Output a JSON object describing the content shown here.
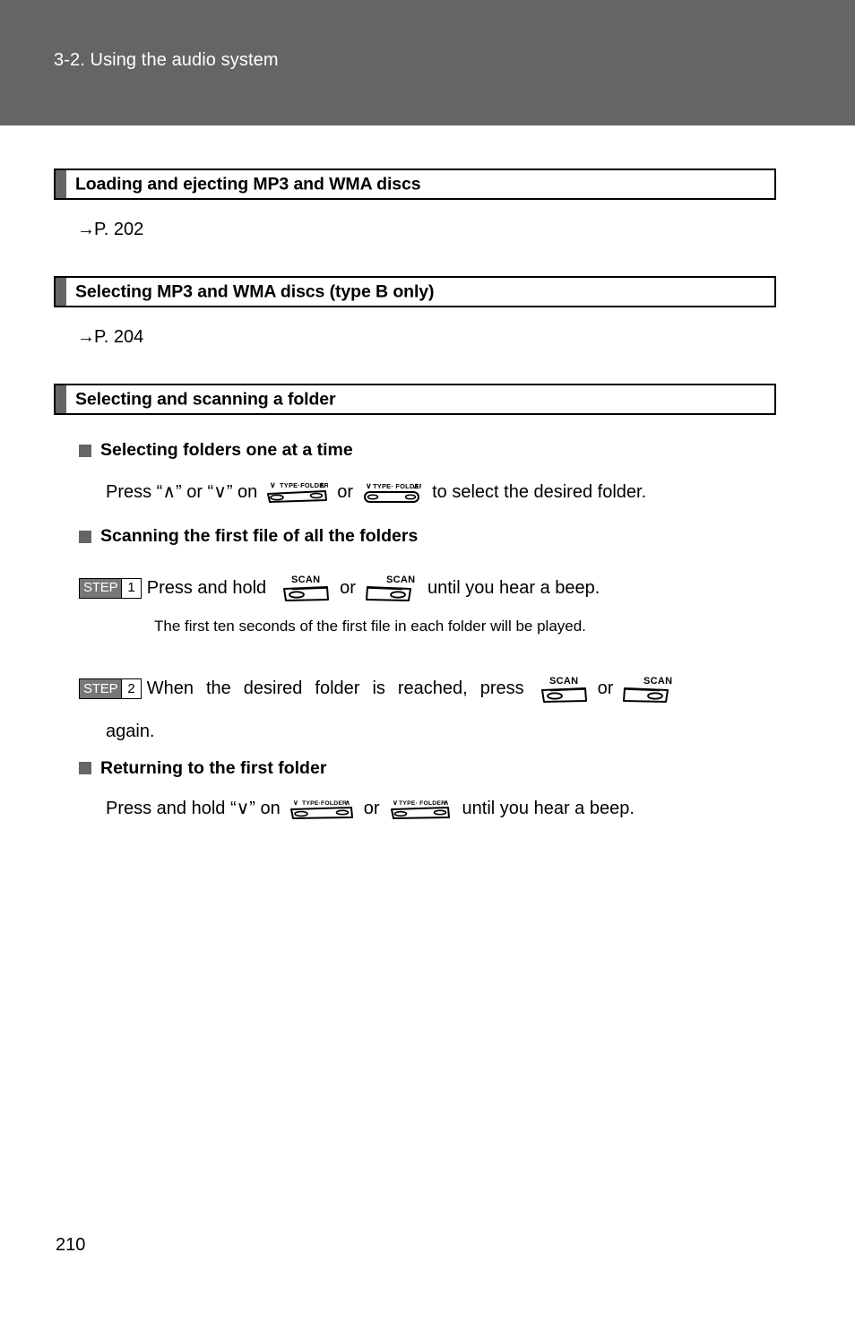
{
  "page": {
    "header_title": "3-2. Using the audio system",
    "page_number": "210"
  },
  "sections": [
    {
      "id": "loading-ejecting",
      "title": "Loading and ejecting MP3 and WMA discs",
      "xref_arrow": "→",
      "xref_text": "P. 202"
    },
    {
      "id": "selecting-discs",
      "title": "Selecting MP3 and WMA discs (type B only)",
      "xref_arrow": "→",
      "xref_text": "P. 204"
    },
    {
      "id": "selecting-scanning-folder",
      "title": "Selecting and scanning a folder"
    }
  ],
  "subsections": {
    "one_at_a_time": {
      "heading": "Selecting folders one at a time",
      "line_pre": "Press “∧” or “∨” on",
      "line_or": "or",
      "line_post": "to select the desired folder."
    },
    "scanning_first_file": {
      "heading": "Scanning the first file of all the folders",
      "step1": {
        "step_word": "STEP",
        "step_num": "1",
        "text_pre": "Press and hold",
        "text_or": "or",
        "text_post": "until you hear a beep."
      },
      "note": "The first ten seconds of the first file in each folder will be played.",
      "step2": {
        "step_word": "STEP",
        "step_num": "2",
        "words": [
          "When",
          "the",
          "desired",
          "folder",
          "is",
          "reached,",
          "press"
        ],
        "text_or": "or",
        "text_continued": "again."
      }
    },
    "returning_first_folder": {
      "heading": "Returning to the first folder",
      "line_pre": "Press and hold “∨” on",
      "line_or": "or",
      "line_post": "until you hear a beep."
    }
  },
  "icons": {
    "type_folder_wide": {
      "name": "type-folder-rocker-wide",
      "label_down": "∨",
      "label_text": "TYPE·FOLDER",
      "label_up": "∧"
    },
    "type_folder_compact": {
      "name": "type-folder-rocker-compact",
      "label_down": "∨",
      "label_text": "TYPE· FOLDER",
      "label_up": "∧"
    },
    "scan_left": {
      "name": "scan-button-left",
      "label": "SCAN"
    },
    "scan_right": {
      "name": "scan-button-right",
      "label": "SCAN"
    }
  },
  "colors": {
    "header_band": "#656565",
    "section_tab": "#656565",
    "bullet_square": "#656565",
    "step_badge_bg": "#777777",
    "text": "#000000",
    "page_bg": "#ffffff"
  }
}
